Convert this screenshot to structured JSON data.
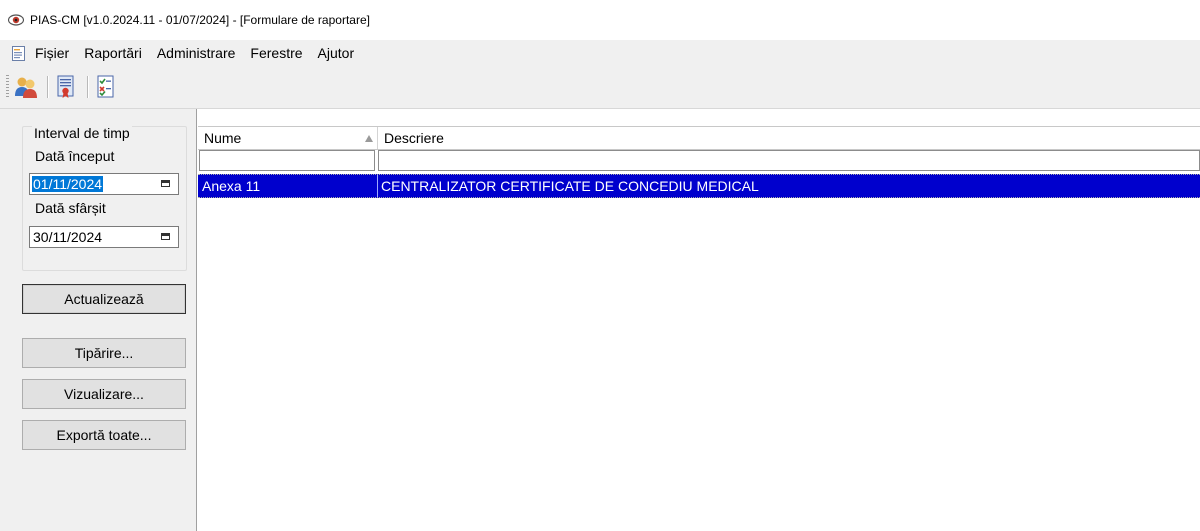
{
  "window": {
    "title": "PIAS-CM [v1.0.2024.11 - 01/07/2024] - [Formulare de raportare]"
  },
  "menu": {
    "items": [
      "Fișier",
      "Raportări",
      "Administrare",
      "Ferestre",
      "Ajutor"
    ]
  },
  "toolbar": {
    "icons": [
      "users-icon",
      "certificate-report-icon",
      "checklist-report-icon"
    ]
  },
  "filters": {
    "group_title": "Interval de timp",
    "start_label": "Dată început",
    "start_value": "01/11/2024",
    "end_label": "Dată sfârșit",
    "end_value": "30/11/2024"
  },
  "buttons": {
    "refresh": "Actualizează",
    "print": "Tipărire...",
    "preview": "Vizualizare...",
    "export_all": "Exportă toate..."
  },
  "grid": {
    "columns": [
      "Nume",
      "Descriere"
    ],
    "sort_column": "Nume",
    "rows": [
      {
        "nume": "Anexa 11",
        "descriere": "CENTRALIZATOR CERTIFICATE DE CONCEDIU MEDICAL",
        "selected": true
      }
    ]
  },
  "colors": {
    "selection": "#0000cd",
    "chrome": "#f0f0f0"
  }
}
